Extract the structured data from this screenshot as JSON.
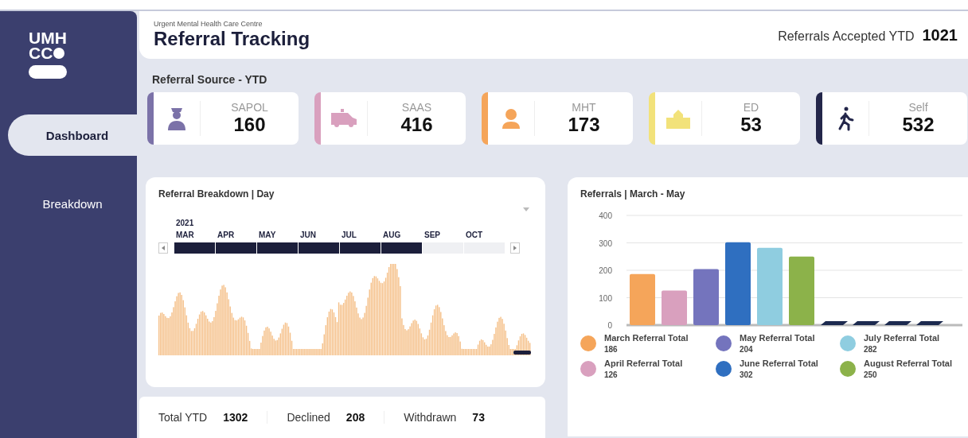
{
  "sidebar": {
    "logo": {
      "line_1": "UMH",
      "line_2": "CC"
    },
    "items": [
      {
        "label": "Dashboard",
        "selected": true
      },
      {
        "label": "Breakdown",
        "selected": false
      }
    ]
  },
  "header": {
    "subtitle": "Urgent Mental Health Care Centre",
    "title": "Referral Tracking",
    "kpi_label": "Referrals Accepted YTD",
    "kpi_value": "1021"
  },
  "sources": {
    "title": "Referral Source - YTD",
    "cards": [
      {
        "kind": "police",
        "label": "SAPOL",
        "value": "160",
        "color": "#7b72a8"
      },
      {
        "kind": "ambulance",
        "label": "SAAS",
        "value": "416",
        "color": "#d9a0be"
      },
      {
        "kind": "headset",
        "label": "MHT",
        "value": "173",
        "color": "#f5a55a"
      },
      {
        "kind": "school",
        "label": "ED",
        "value": "53",
        "color": "#f2e27a"
      },
      {
        "kind": "walker",
        "label": "Self",
        "value": "532",
        "color": "#23264a"
      }
    ]
  },
  "daily": {
    "title": "Referral Breakdown | Day",
    "year": "2021",
    "months": [
      {
        "label": "MAR",
        "selected": true
      },
      {
        "label": "APR",
        "selected": true
      },
      {
        "label": "MAY",
        "selected": true
      },
      {
        "label": "JUN",
        "selected": true
      },
      {
        "label": "JUL",
        "selected": true
      },
      {
        "label": "AUG",
        "selected": true
      },
      {
        "label": "SEP",
        "selected": false
      },
      {
        "label": "OCT",
        "selected": false
      }
    ]
  },
  "totals": [
    {
      "label": "Total YTD",
      "value": "1302"
    },
    {
      "label": "Declined",
      "value": "208"
    },
    {
      "label": "Withdrawn",
      "value": "73"
    }
  ],
  "monthly": {
    "title": "Referrals | March - May",
    "chart_data": {
      "type": "bar",
      "grid": true,
      "value_labels": [
        "186",
        "126",
        "204",
        "302",
        "282",
        "250"
      ],
      "yticks": [
        0,
        100,
        200,
        300,
        400
      ],
      "ylim": [
        0,
        400
      ],
      "series": [
        {
          "name": "March Referral Total",
          "color": "#f5a55a",
          "values": [
            186
          ]
        },
        {
          "name": "April Referral Total",
          "color": "#d9a0be",
          "values": [
            126
          ]
        },
        {
          "name": "May Referral Total",
          "color": "#7474bd",
          "values": [
            204
          ]
        },
        {
          "name": "June Referral Total",
          "color": "#2f6fc0",
          "values": [
            302
          ]
        },
        {
          "name": "July Referral Total",
          "color": "#8fcde0",
          "values": [
            282
          ]
        },
        {
          "name": "August Referral Total",
          "color": "#8cb24a",
          "values": [
            250
          ]
        }
      ]
    }
  }
}
